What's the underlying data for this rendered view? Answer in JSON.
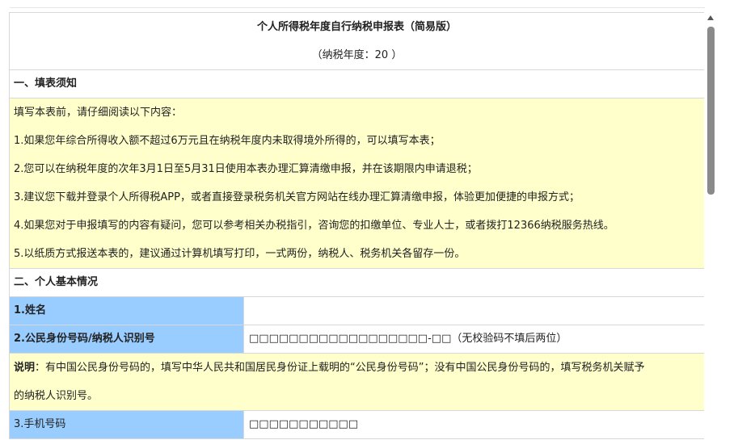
{
  "form": {
    "title": "个人所得税年度自行纳税申报表（简易版）",
    "tax_year": "（纳税年度：20 ）"
  },
  "section1": {
    "heading": "一、填表须知",
    "lines": [
      "填写本表前，请仔细阅读以下内容：",
      "1.如果您年综合所得收入额不超过6万元且在纳税年度内未取得境外所得的，可以填写本表；",
      "2.您可以在纳税年度的次年3月1日至5月31日使用本表办理汇算清缴申报，并在该期限内申请退税；",
      "3.建议您下载并登录个人所得税APP，或者直接登录税务机关官方网站在线办理汇算清缴申报，体验更加便捷的申报方式；",
      "4.如果您对于申报填写的内容有疑问，您可以参考相关办税指引，咨询您的扣缴单位、专业人士，或者拨打12366纳税服务热线。",
      "5.以纸质方式报送本表的，建议通过计算机填写打印，一式两份，纳税人、税务机关各留存一份。"
    ]
  },
  "section2": {
    "heading": "二、个人基本情况",
    "name_label": "1.姓名",
    "name_value": "",
    "id_label": "2.公民身份号码/纳税人识别号",
    "id_value": "□□□□□□□□□□□□□□□□□□-□□（无校验码不填后两位）",
    "explain_prefix": "说明",
    "explain_line1": "：有中国公民身份号码的，填写中华人民共和国居民身份证上载明的“公民身份号码”；没有中国公民身份号码的，填写税务机关赋予",
    "explain_line2": "的纳税人识别号。",
    "phone_label": "3.手机号码",
    "phone_value": "□□□□□□□□□□□"
  }
}
